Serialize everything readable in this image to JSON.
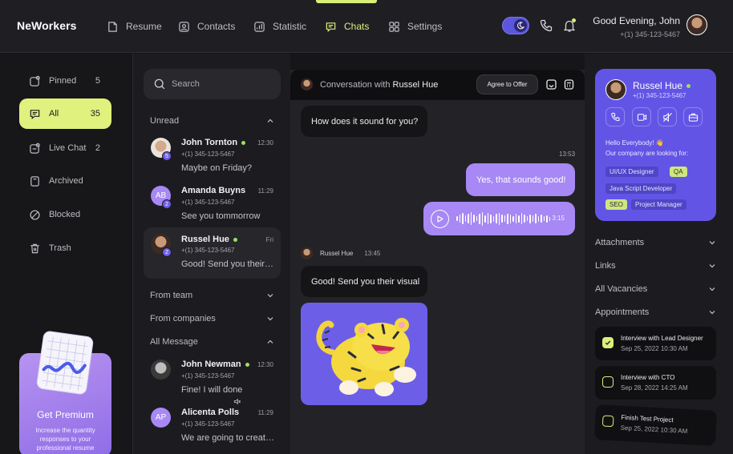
{
  "app": {
    "logo": "NeWorkers"
  },
  "nav": [
    {
      "label": "Resume",
      "icon": "resume-icon"
    },
    {
      "label": "Contacts",
      "icon": "contacts-icon"
    },
    {
      "label": "Statistic",
      "icon": "statistic-icon"
    },
    {
      "label": "Chats",
      "icon": "chats-icon",
      "active": true
    },
    {
      "label": "Settings",
      "icon": "settings-icon"
    }
  ],
  "user": {
    "greeting": "Good Evening, John",
    "phone": "+(1) 345-123-5467"
  },
  "sidebar": {
    "items": [
      {
        "label": "Pinned",
        "count": "5"
      },
      {
        "label": "All",
        "count": "35",
        "active": true
      },
      {
        "label": "Live Chat",
        "count": "2"
      },
      {
        "label": "Archived",
        "count": ""
      },
      {
        "label": "Blocked",
        "count": ""
      },
      {
        "label": "Trash",
        "count": ""
      }
    ]
  },
  "premium": {
    "title": "Get Premium",
    "desc": "Increase the quantity responses to your professional resume"
  },
  "search": {
    "placeholder": "Search"
  },
  "chatlist": {
    "sections": {
      "unread": "Unread",
      "team": "From team",
      "companies": "From companies",
      "all": "All Message"
    },
    "chats": [
      {
        "name": "John Tornton",
        "phone": "+(1) 345-123-5467",
        "time": "12:30",
        "message": "Maybe on Friday?",
        "badge": "5",
        "online": true
      },
      {
        "name": "Amanda Buyns",
        "phone": "+(1) 345-123-5467",
        "time": "11:29",
        "message": "See you tommorrow",
        "badge": "2",
        "initials": "AB"
      },
      {
        "name": "Russel Hue",
        "phone": "+(1) 345-123-5467",
        "time": "Fri",
        "message": "Good! Send you their…",
        "badge": "2",
        "online": true
      },
      {
        "name": "John Newman",
        "phone": "+(1) 345-123-5467",
        "time": "12:30",
        "message": "Fine! I will done",
        "online": true
      },
      {
        "name": "Alicenta Polls",
        "phone": "+(1) 345-123-5467",
        "time": "11:29",
        "message": "We are going to creat…",
        "initials": "AP"
      }
    ]
  },
  "conversation": {
    "title_prefix": "Conversation with",
    "contact": "Russel Hue",
    "agree_label": "Agree to Offer",
    "messages": {
      "m1": "How does it sound for you?",
      "t1": "13:53",
      "m2": "Yes, that sounds good!",
      "voice_time": "3:15",
      "sender": "Russel Hue",
      "sender_time": "13:45",
      "m3": "Good! Send you their visual"
    }
  },
  "profile": {
    "name": "Russel Hue",
    "phone": "+(1) 345-123-5467",
    "greeting": "Hello Everybody! 👋",
    "intro": "Our company are looking for:",
    "tags": [
      "UI/UX Designer",
      "QA",
      "Java Script Developer",
      "SEO",
      "Project Manager"
    ]
  },
  "accordion": [
    "Attachments",
    "Links",
    "All Vacancies",
    "Appointments"
  ],
  "appointments": [
    {
      "title": "Interview with Lead Designer",
      "date": "Sep 25, 2022 10:30 AM",
      "checked": true
    },
    {
      "title": "Interview with CTO",
      "date": "Sep 28, 2022 14:25 AM",
      "checked": false
    },
    {
      "title": "Finish Test Project",
      "date": "Sep 25, 2022 10:30 AM",
      "checked": false
    }
  ],
  "colors": {
    "accent": "#d9ef7c",
    "purple": "#a788f4",
    "indigo": "#6255e6"
  }
}
